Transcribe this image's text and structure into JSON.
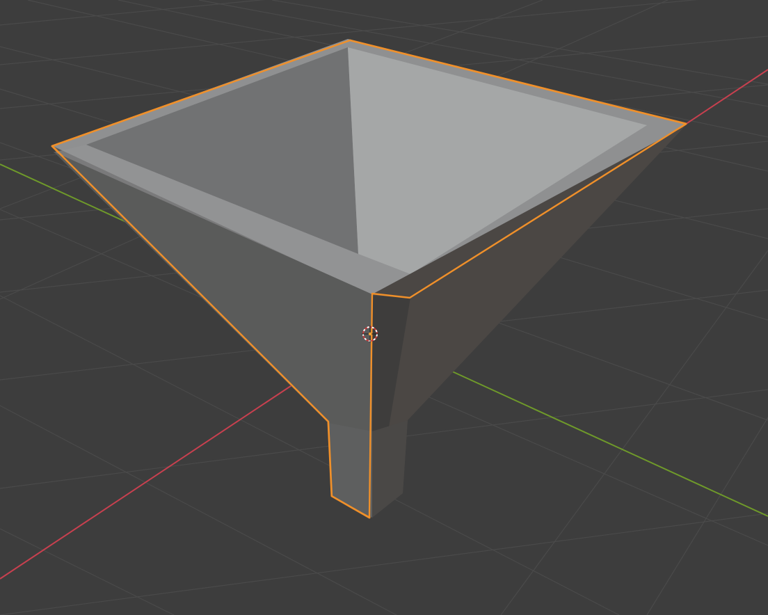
{
  "viewport": {
    "mode": "3D Viewport",
    "background_color": "#3d3d3d",
    "grid_color": "#4a4a4a",
    "x_axis_color": "#c8404f",
    "y_axis_color": "#6f9a2a",
    "selection_outline_color": "#f0902a"
  },
  "scene": {
    "selected_object": "funnel",
    "object_color_top": "#8f9091",
    "object_color_inner_left": "#707172",
    "object_color_inner_right": "#a4a6a6",
    "object_color_side_left": "#5b5c5b",
    "object_color_side_right": "#4a4643",
    "object_color_spout": "#5a5b5b",
    "origin_marker": "3d-cursor"
  }
}
